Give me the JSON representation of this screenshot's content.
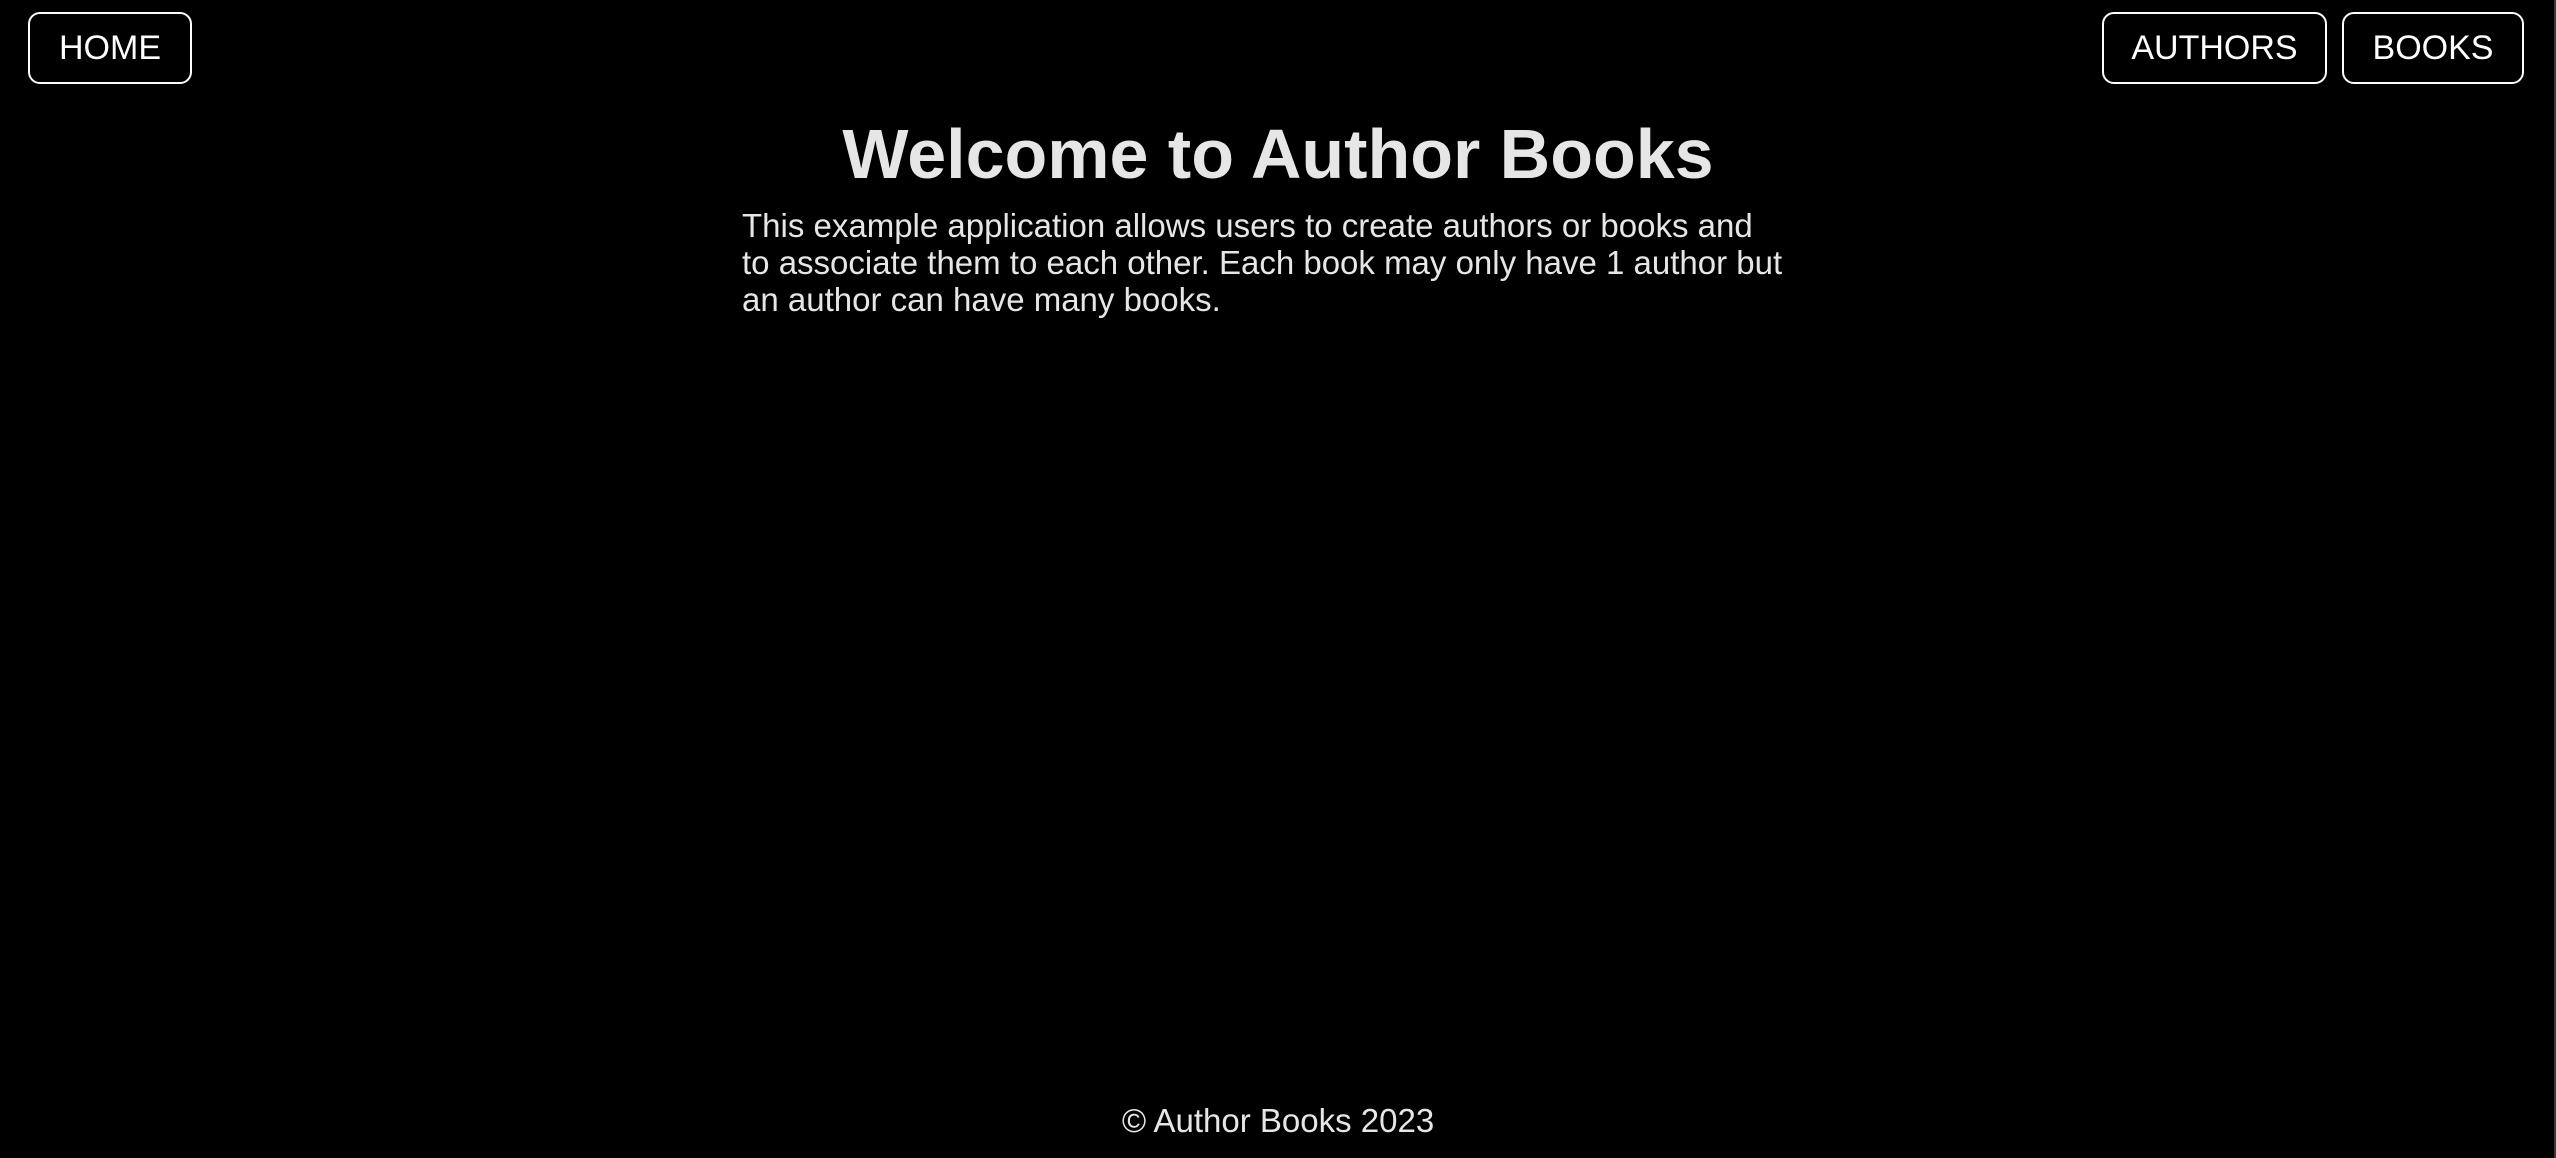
{
  "nav": {
    "home_label": "HOME",
    "authors_label": "AUTHORS",
    "books_label": "BOOKS"
  },
  "main": {
    "title": "Welcome to Author Books",
    "description": "This example application allows users to create authors or books and to associate them to each other. Each book may only have 1 author but an author can have many books."
  },
  "footer": {
    "copyright": "© Author Books 2023"
  },
  "colors": {
    "background": "#000000",
    "text": "#e6e6e6",
    "button_border": "#ffffff"
  }
}
